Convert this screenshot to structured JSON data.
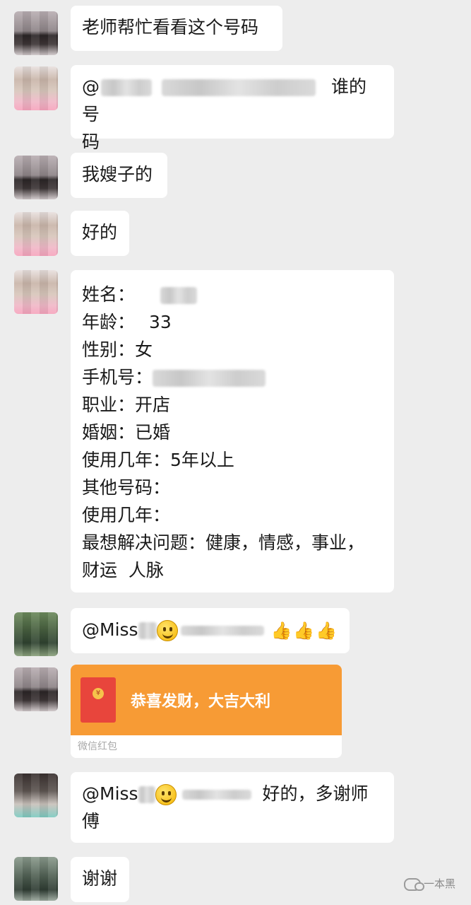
{
  "messages": [
    {
      "text": "老师帮忙看看这个号码"
    },
    {
      "prefix": "@",
      "suffix_line1": "谁的号",
      "suffix_line2": "码"
    },
    {
      "text": "我嫂子的"
    },
    {
      "text": "好的"
    },
    {
      "fields": [
        {
          "label": "姓名：",
          "value": ""
        },
        {
          "label": "年龄：",
          "value": "33"
        },
        {
          "label": "性别：",
          "value": "女"
        },
        {
          "label": "手机号：",
          "value": ""
        },
        {
          "label": "职业：",
          "value": "开店"
        },
        {
          "label": "婚姻：",
          "value": "已婚"
        },
        {
          "label": "使用几年：",
          "value": "5年以上"
        },
        {
          "label": "其他号码：",
          "value": ""
        },
        {
          "label": "使用几年：",
          "value": ""
        },
        {
          "label": "最想解决问题：",
          "value": "健康，情感，事业，"
        }
      ],
      "last_line": "财运  人脉"
    },
    {
      "prefix": "@Miss"
    },
    {
      "red_packet": {
        "greeting": "恭喜发财，大吉大利",
        "footer": "微信红包"
      }
    },
    {
      "prefix": "@Miss",
      "suffix_line1": "好的，多谢师",
      "suffix_line2": "傅"
    },
    {
      "text": "谢谢"
    }
  ],
  "watermark": {
    "text": "一本黑"
  },
  "icons": [
    "avatar",
    "smile-emoji-icon",
    "thumbs-up-icon",
    "red-envelope-icon",
    "wechat-logo-icon"
  ]
}
